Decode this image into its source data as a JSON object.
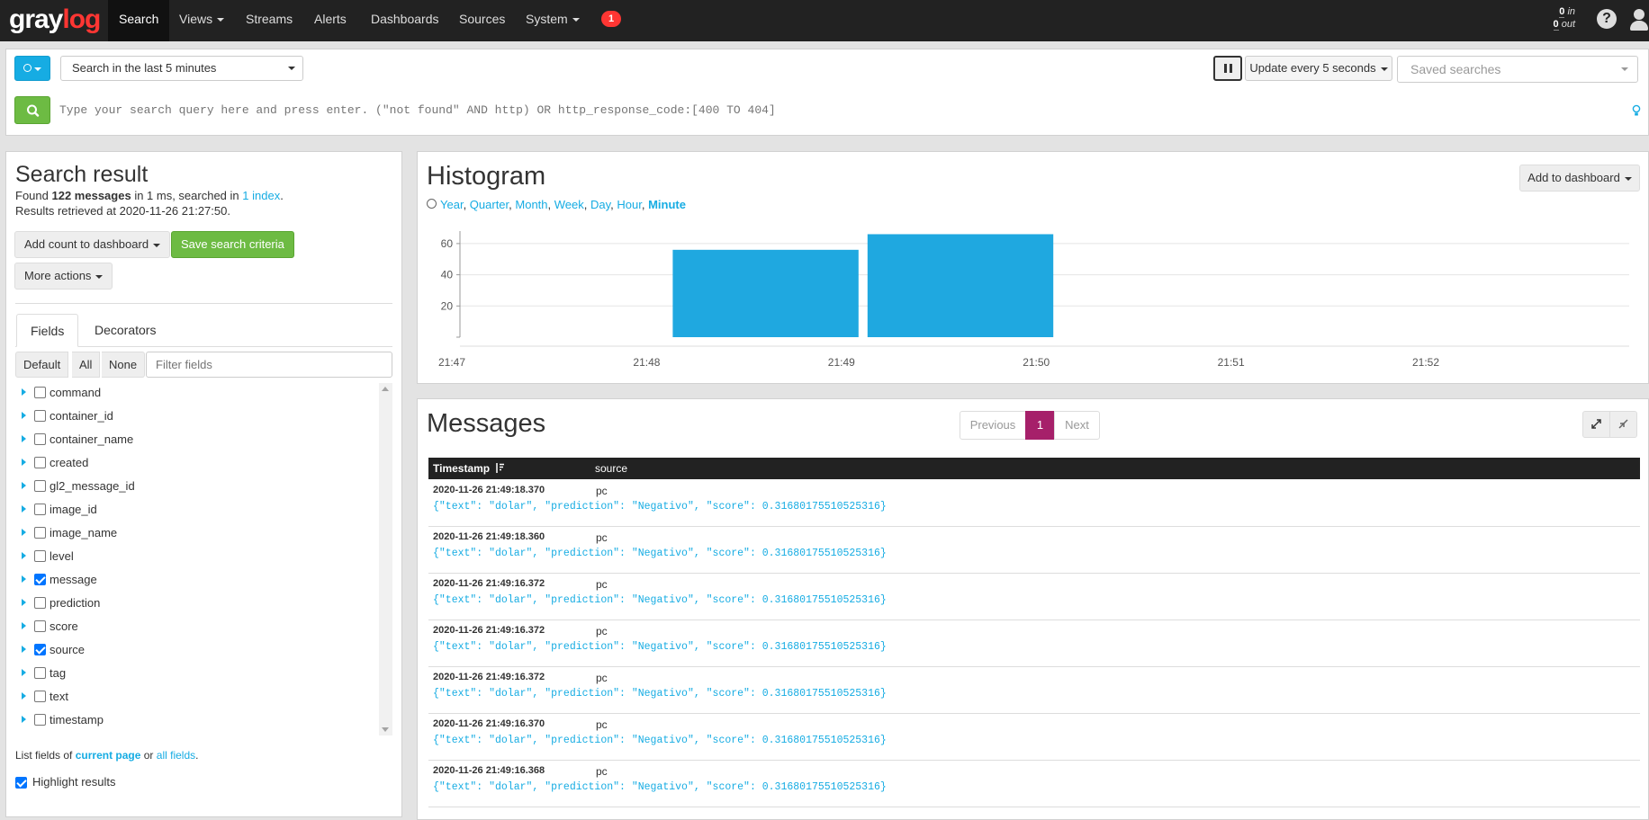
{
  "nav": {
    "brand_part1": "gray",
    "brand_part2": "log",
    "items": [
      "Search",
      "Views",
      "Streams",
      "Alerts",
      "Dashboards",
      "Sources",
      "System"
    ],
    "notification_count": "1",
    "throughput_in": "0",
    "throughput_in_label": "in",
    "throughput_out": "0",
    "throughput_out_label": "out",
    "help_icon": "question-circle-icon",
    "user_icon": "user-icon",
    "colors": {
      "bar": "#222222",
      "brand_accent": "#ff3633",
      "badge": "#ff3633"
    }
  },
  "search": {
    "time_range": "Search in the last 5 minutes",
    "refresh_label": "Update every 5 seconds",
    "saved_searches_placeholder": "Saved searches",
    "query_placeholder": "Type your search query here and press enter. (\"not found\" AND http) OR http_response_code:[400 TO 404]",
    "search_icon": "search-icon",
    "pause_icon": "pause-icon",
    "help_bulb_icon": "lightbulb-icon",
    "colors": {
      "primary": "#16ace3",
      "success": "#6dbb43"
    }
  },
  "result": {
    "title": "Search result",
    "found_prefix": "Found",
    "message_count": "122 messages",
    "found_mid": "in 1 ms, searched in",
    "index_link": "1 index",
    "found_suffix": ".",
    "retrieved": "Results retrieved at 2020-11-26 21:27:50.",
    "add_count_button": "Add count to dashboard",
    "save_criteria_button": "Save search criteria",
    "more_actions_button": "More actions"
  },
  "fields_panel": {
    "tabs": [
      "Fields",
      "Decorators"
    ],
    "filter_buttons": [
      "Default",
      "All",
      "None"
    ],
    "filter_placeholder": "Filter fields",
    "fields": [
      {
        "name": "command",
        "checked": false
      },
      {
        "name": "container_id",
        "checked": false
      },
      {
        "name": "container_name",
        "checked": false
      },
      {
        "name": "created",
        "checked": false
      },
      {
        "name": "gl2_message_id",
        "checked": false
      },
      {
        "name": "image_id",
        "checked": false
      },
      {
        "name": "image_name",
        "checked": false
      },
      {
        "name": "level",
        "checked": false
      },
      {
        "name": "message",
        "checked": true
      },
      {
        "name": "prediction",
        "checked": false
      },
      {
        "name": "score",
        "checked": false
      },
      {
        "name": "source",
        "checked": true
      },
      {
        "name": "tag",
        "checked": false
      },
      {
        "name": "text",
        "checked": false
      },
      {
        "name": "timestamp",
        "checked": false
      }
    ],
    "list_prefix": "List fields of",
    "current_page_link": "current page",
    "or_text": "or",
    "all_fields_link": "all fields",
    "list_suffix": ".",
    "highlight_label": "Highlight results",
    "highlight_checked": true
  },
  "histogram": {
    "title": "Histogram",
    "resolutions": [
      "Year",
      "Quarter",
      "Month",
      "Week",
      "Day",
      "Hour",
      "Minute"
    ],
    "active_resolution": "Minute",
    "add_to_dashboard": "Add to dashboard",
    "clock_icon": "clock-icon"
  },
  "chart_data": {
    "type": "bar",
    "title": "Histogram",
    "x_ticks": [
      "21:47",
      "21:48",
      "21:49",
      "21:50",
      "21:51",
      "21:52"
    ],
    "categories": [
      "21:48",
      "21:49"
    ],
    "values": [
      56,
      66
    ],
    "y_ticks": [
      20,
      40,
      60
    ],
    "ylim": [
      0,
      68
    ],
    "xlabel": "",
    "ylabel": "",
    "grid": true,
    "bar_color": "#1fa8e0"
  },
  "messages": {
    "title": "Messages",
    "pagination": {
      "previous": "Previous",
      "current": "1",
      "next": "Next"
    },
    "expand_icon": "expand-icon",
    "compress_icon": "compress-icon",
    "columns": [
      "Timestamp",
      "source"
    ],
    "sort_icon": "sort-amount-desc-icon",
    "rows": [
      {
        "timestamp": "2020-11-26 21:49:18.370",
        "source": "pc",
        "message": "{\"text\": \"dolar\", \"prediction\": \"Negativo\", \"score\": 0.31680175510525316}"
      },
      {
        "timestamp": "2020-11-26 21:49:18.360",
        "source": "pc",
        "message": "{\"text\": \"dolar\", \"prediction\": \"Negativo\", \"score\": 0.31680175510525316}"
      },
      {
        "timestamp": "2020-11-26 21:49:16.372",
        "source": "pc",
        "message": "{\"text\": \"dolar\", \"prediction\": \"Negativo\", \"score\": 0.31680175510525316}"
      },
      {
        "timestamp": "2020-11-26 21:49:16.372",
        "source": "pc",
        "message": "{\"text\": \"dolar\", \"prediction\": \"Negativo\", \"score\": 0.31680175510525316}"
      },
      {
        "timestamp": "2020-11-26 21:49:16.372",
        "source": "pc",
        "message": "{\"text\": \"dolar\", \"prediction\": \"Negativo\", \"score\": 0.31680175510525316}"
      },
      {
        "timestamp": "2020-11-26 21:49:16.370",
        "source": "pc",
        "message": "{\"text\": \"dolar\", \"prediction\": \"Negativo\", \"score\": 0.31680175510525316}"
      },
      {
        "timestamp": "2020-11-26 21:49:16.368",
        "source": "pc",
        "message": "{\"text\": \"dolar\", \"prediction\": \"Negativo\", \"score\": 0.31680175510525316}"
      }
    ]
  }
}
